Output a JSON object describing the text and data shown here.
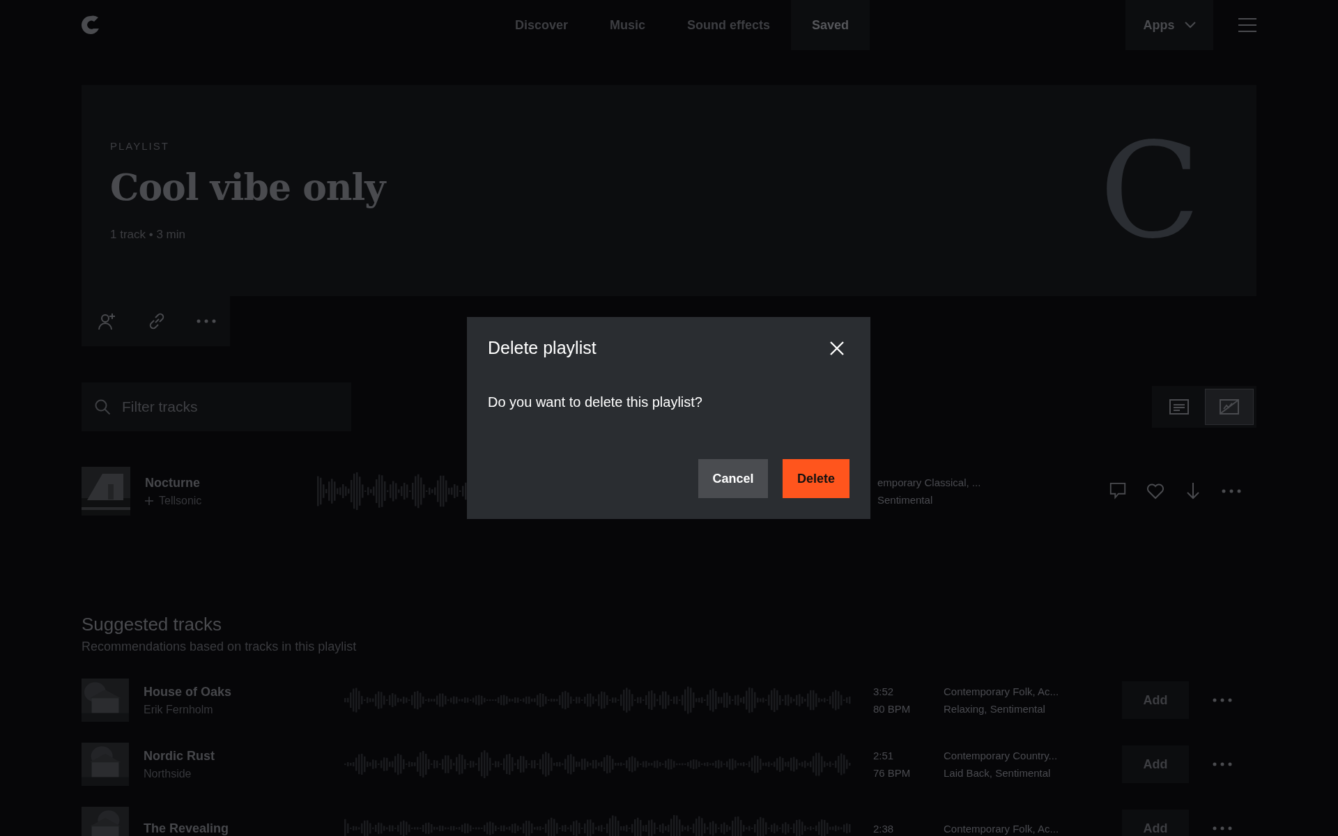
{
  "nav": {
    "items": [
      {
        "label": "Discover",
        "selected": false
      },
      {
        "label": "Music",
        "selected": false
      },
      {
        "label": "Sound effects",
        "selected": false
      },
      {
        "label": "Saved",
        "selected": true
      }
    ],
    "apps": "Apps"
  },
  "header": {
    "eyebrow": "PLAYLIST",
    "title": "Cool vibe only",
    "meta": "1 track • 3 min",
    "cover_letter": "C"
  },
  "filter": {
    "placeholder": "Filter tracks"
  },
  "view_toggle": [
    {
      "kind": "list",
      "selected": false
    },
    {
      "kind": "waveform",
      "selected": true
    }
  ],
  "tracks": [
    {
      "title": "Nocturne",
      "artist": "Tellsonic",
      "genres": "emporary Classical, ...",
      "moods": "Sentimental"
    }
  ],
  "suggested": {
    "title": "Suggested tracks",
    "subtitle": "Recommendations based on tracks in this playlist",
    "rows": [
      {
        "title": "House of Oaks",
        "artist": "Erik Fernholm",
        "duration": "3:52",
        "bpm": "80 BPM",
        "genres": "Contemporary Folk, Ac...",
        "moods": "Relaxing, Sentimental",
        "button": "Add"
      },
      {
        "title": "Nordic Rust",
        "artist": "Northside",
        "duration": "2:51",
        "bpm": "76 BPM",
        "genres": "Contemporary Country...",
        "moods": "Laid Back, Sentimental",
        "button": "Add"
      },
      {
        "title": "The Revealing",
        "duration": "2:38",
        "genres": "Contemporary Folk, Ac...",
        "button": "Add"
      }
    ]
  },
  "dialog": {
    "title": "Delete playlist",
    "message": "Do you want to delete this playlist?",
    "buttons": [
      {
        "kind": "secondary",
        "label": "Cancel"
      },
      {
        "kind": "danger",
        "label": "Delete"
      }
    ]
  }
}
